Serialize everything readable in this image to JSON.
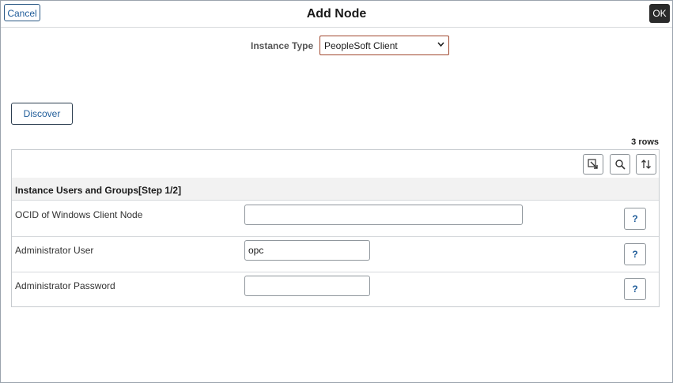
{
  "header": {
    "cancel_label": "Cancel",
    "title": "Add Node",
    "ok_label": "OK"
  },
  "instance_type": {
    "label": "Instance Type",
    "selected": "PeopleSoft Client"
  },
  "discover_label": "Discover",
  "grid": {
    "row_count": "3 rows",
    "toolbar_icons": [
      "export-icon",
      "search-icon",
      "sort-icon"
    ],
    "section_title": "Instance Users and Groups[Step 1/2]",
    "rows": [
      {
        "label": "OCID of Windows Client Node",
        "value": "",
        "help": "?"
      },
      {
        "label": "Administrator User",
        "value": "opc",
        "help": "?"
      },
      {
        "label": "Administrator Password",
        "value": "",
        "help": "?"
      }
    ]
  },
  "colors": {
    "accent_blue": "#1f5c99",
    "select_border": "#a0472e",
    "ok_bg": "#2b2b2b"
  }
}
